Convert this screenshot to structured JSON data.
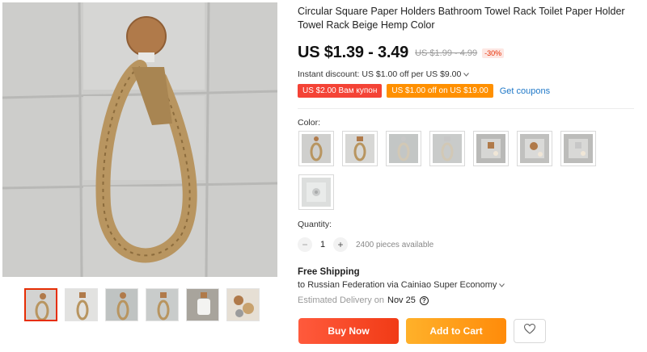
{
  "product": {
    "title": "Circular Square Paper Holders Bathroom Towel Rack Toilet Paper Holder Towel Rack Beige Hemp Color",
    "price": "US $1.39 - 3.49",
    "original_price": "US $1.99 - 4.99",
    "discount": "-30%"
  },
  "instant_discount": {
    "text": "Instant discount: US $1.00 off per US $9.00"
  },
  "coupons": {
    "items": [
      "US $2.00 Вам купон",
      "US $1.00 off on US $19.00"
    ],
    "get_label": "Get coupons"
  },
  "color": {
    "label": "Color:",
    "swatch_count": 8
  },
  "quantity": {
    "label": "Quantity:",
    "value": "1",
    "minus": "−",
    "plus": "+",
    "available": "2400 pieces available"
  },
  "shipping": {
    "title": "Free Shipping",
    "to": "to Russian Federation via Cainiao Super Economy",
    "estimated_label": "Estimated Delivery on",
    "estimated_date": "Nov 25",
    "help": "?"
  },
  "actions": {
    "buy": "Buy Now",
    "cart": "Add to Cart"
  },
  "colors": {
    "accent_red": "#e62e04",
    "price_text": "#111111",
    "buy_button": "#f13b16",
    "cart_button": "#ff8b0a",
    "coupon_red": "#f44336",
    "coupon_orange": "#ff9000",
    "link_blue": "#1f78c8"
  },
  "icons": [
    "chevron-down-icon",
    "question-icon",
    "heart-icon"
  ]
}
